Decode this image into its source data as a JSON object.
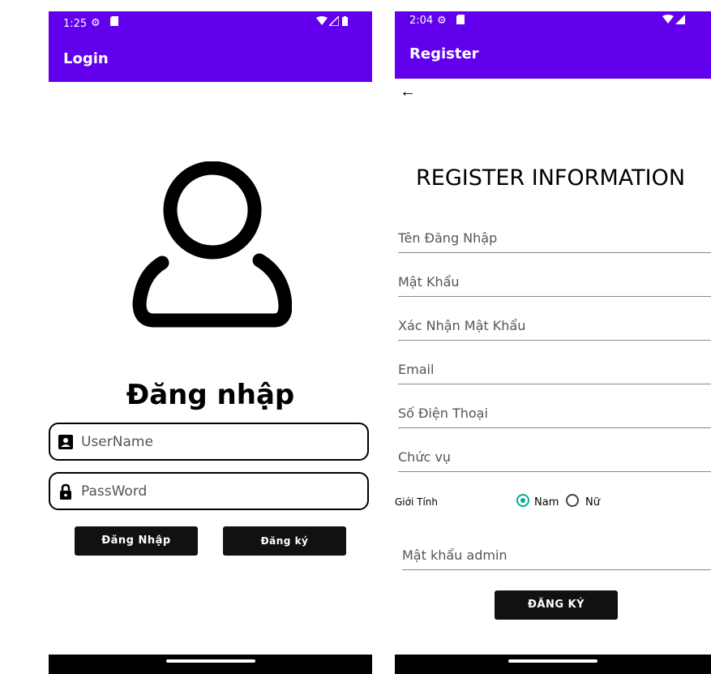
{
  "login": {
    "status_time": "1:25",
    "app_title": "Login",
    "heading": "Đăng nhập",
    "username_placeholder": "UserName",
    "password_placeholder": "PassWord",
    "login_button": "Đăng Nhập",
    "register_button": "Đăng ký"
  },
  "register": {
    "status_time": "2:04",
    "app_title": "Register",
    "heading": "REGISTER INFORMATION",
    "fields": [
      "Tên Đăng Nhập",
      "Mật Khẩu",
      "Xác Nhận Mật Khẩu",
      "Email",
      "Số Điện Thoại",
      "Chức vụ"
    ],
    "gender_label": "Giới Tính",
    "gender_options": [
      "Nam",
      "Nữ"
    ],
    "gender_selected": "Nam",
    "admin_password": "Mật khẩu admin",
    "submit_button": "ĐĂNG KÝ"
  },
  "colors": {
    "app_bar": "#6200EE",
    "button": "#111111",
    "radio_selected": "#08A89A"
  },
  "icons": [
    "settings-icon",
    "sim-card-icon",
    "wifi-icon",
    "signal-icon",
    "battery-icon",
    "person-icon",
    "contact-card-icon",
    "lock-icon",
    "back-arrow-icon"
  ]
}
